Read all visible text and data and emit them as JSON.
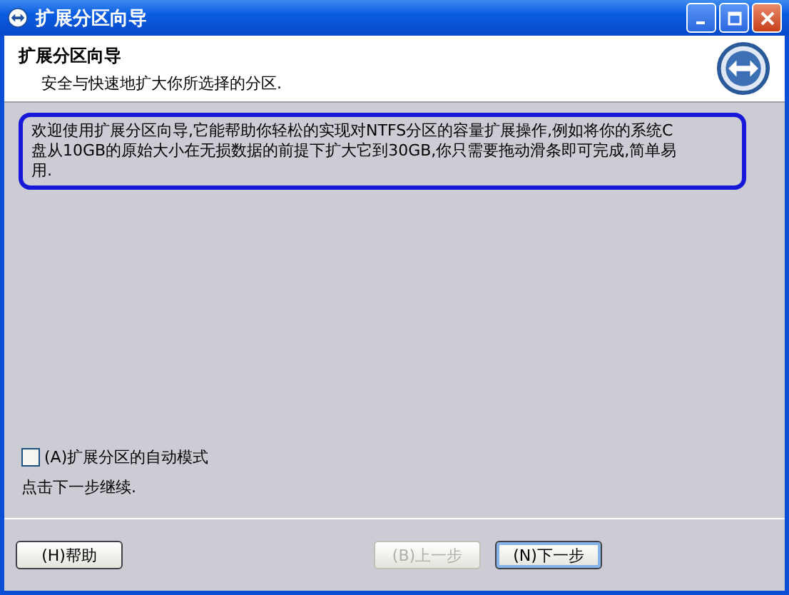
{
  "window": {
    "title": "扩展分区向导"
  },
  "header": {
    "title": "扩展分区向导",
    "subtitle": "安全与快速地扩大你所选择的分区."
  },
  "intro": "欢迎使用扩展分区向导,它能帮助你轻松的实现对NTFS分区的容量扩展操作,例如将你的系统C盘从10GB的原始大小在无损数据的前提下扩大它到30GB,你只需要拖动滑条即可完成,简单易用.",
  "auto_mode": {
    "label": "(A)扩展分区的自动模式",
    "checked": false
  },
  "hint": "点击下一步继续.",
  "buttons": [
    {
      "label": "(H)帮助",
      "disabled": false,
      "default": false,
      "kind": "help"
    },
    {
      "label": "(B)上一步",
      "disabled": true,
      "default": false,
      "kind": "nav"
    },
    {
      "label": "(N)下一步",
      "disabled": false,
      "default": true,
      "kind": "nav"
    }
  ]
}
